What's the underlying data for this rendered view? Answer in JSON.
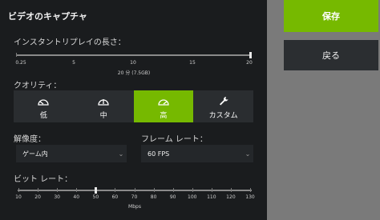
{
  "panel": {
    "title": "ビデオのキャプチャ"
  },
  "replay": {
    "label": "インスタントリプレイの長さ：",
    "tick_labels": [
      "0.25",
      "5",
      "10",
      "15",
      "20"
    ],
    "value_text": "20 分 (7.5GB)",
    "value_minutes": 20,
    "min": 0.25,
    "max": 20
  },
  "quality": {
    "label": "クオリティ：",
    "options": [
      {
        "label": "低",
        "icon": "gauge-low-icon"
      },
      {
        "label": "中",
        "icon": "gauge-medium-icon"
      },
      {
        "label": "高",
        "icon": "gauge-high-icon"
      },
      {
        "label": "カスタム",
        "icon": "wrench-icon"
      }
    ],
    "selected_index": 2
  },
  "resolution": {
    "label": "解像度：",
    "value": "ゲーム内"
  },
  "framerate": {
    "label": "フレーム レート：",
    "value": "60 FPS"
  },
  "bitrate": {
    "label": "ビット レート：",
    "tick_labels": [
      "10",
      "20",
      "30",
      "40",
      "50",
      "60",
      "70",
      "80",
      "90",
      "100",
      "110",
      "120",
      "130"
    ],
    "unit": "Mbps",
    "value": 50,
    "min": 10,
    "max": 130
  },
  "actions": {
    "save": "保存",
    "back": "戻る"
  },
  "colors": {
    "accent": "#76b900",
    "panel": "#1a1c1e",
    "background": "#7a7a7a"
  }
}
